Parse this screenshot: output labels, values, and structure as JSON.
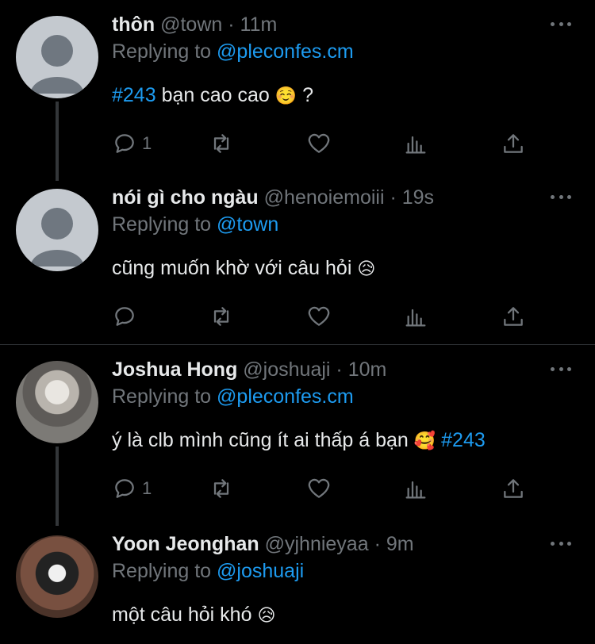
{
  "tweets": [
    {
      "name": "thôn",
      "handle": "@town",
      "time": "11m",
      "replying_label": "Replying to",
      "replying_to": "@pleconfes.cm",
      "text_parts": {
        "hashtag": "#243",
        "body": "bạn cao cao",
        "emoji": "☺️",
        "suffix": "?"
      },
      "reply_count": "1",
      "avatar": "default-avatar"
    },
    {
      "name": "nói gì cho ngàu",
      "handle": "@henoiemoiii",
      "time": "19s",
      "replying_label": "Replying to",
      "replying_to": "@town",
      "text_parts": {
        "body": "cũng muốn khờ với câu hỏi",
        "emoji": "😥"
      },
      "reply_count": "",
      "avatar": "default-avatar"
    },
    {
      "name": "Joshua Hong",
      "handle": "@joshuaji",
      "time": "10m",
      "replying_label": "Replying to",
      "replying_to": "@pleconfes.cm",
      "text_parts": {
        "body": "ý là clb mình cũng ít ai thấp á bạn",
        "emoji": "🥰",
        "hashtag": "#243"
      },
      "reply_count": "1",
      "avatar": "photo-avatar"
    },
    {
      "name": "Yoon Jeonghan",
      "handle": "@yjhnieyaa",
      "time": "9m",
      "replying_label": "Replying to",
      "replying_to": "@joshuaji",
      "text_parts": {
        "body": "một câu hỏi khó",
        "emoji": "😥"
      },
      "avatar": "photo-avatar"
    }
  ],
  "separator": "·",
  "icons": [
    "reply-icon",
    "retweet-icon",
    "like-icon",
    "analytics-icon",
    "share-icon",
    "more-icon"
  ],
  "colors": {
    "background": "#000000",
    "text": "#e7e9ea",
    "muted": "#71767b",
    "link": "#1d9bf0",
    "thread_line": "#333639"
  }
}
